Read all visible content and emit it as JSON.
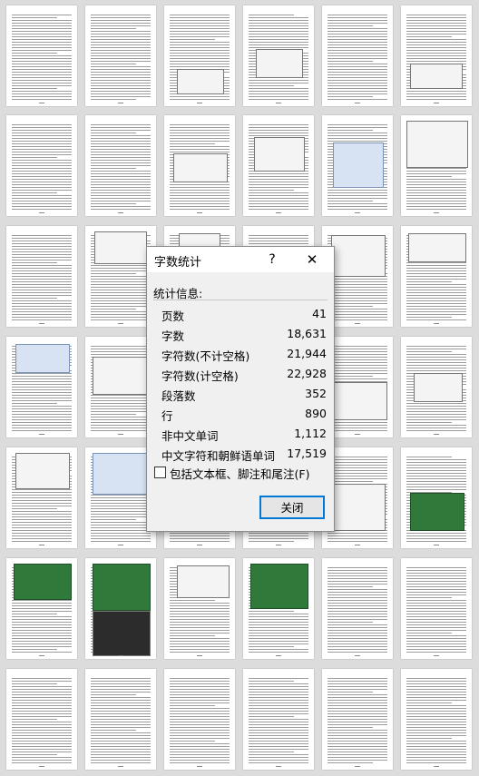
{
  "dialog": {
    "title": "字数统计",
    "help_label": "?",
    "close_glyph": "✕",
    "section_label": "统计信息:",
    "stats": [
      {
        "label": "页数",
        "value": "41"
      },
      {
        "label": "字数",
        "value": "18,631"
      },
      {
        "label": "字符数(不计空格)",
        "value": "21,944"
      },
      {
        "label": "字符数(计空格)",
        "value": "22,928"
      },
      {
        "label": "段落数",
        "value": "352"
      },
      {
        "label": "行",
        "value": "890"
      },
      {
        "label": "非中文单词",
        "value": "1,112"
      },
      {
        "label": "中文字符和朝鲜语单词",
        "value": "17,519"
      }
    ],
    "checkbox_label": "包括文本框、脚注和尾注(F)",
    "checkbox_checked": false,
    "close_button_label": "关闭"
  },
  "document_preview": {
    "page_count_visible": 42
  }
}
